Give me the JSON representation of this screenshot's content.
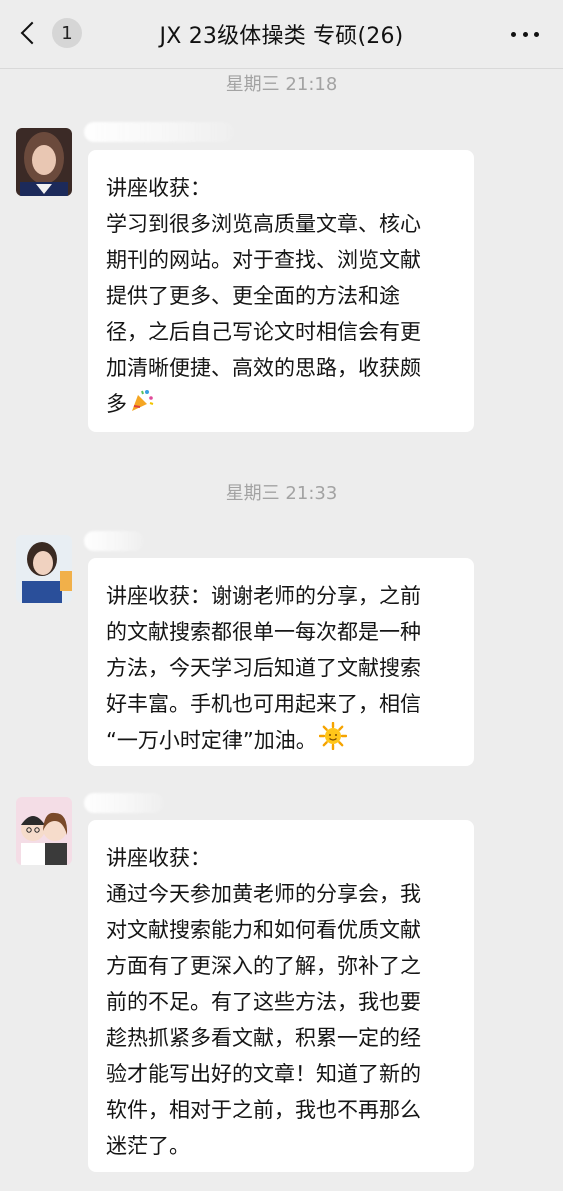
{
  "header": {
    "back_count": "1",
    "title": "JX 23级体操类 专硕(26)"
  },
  "messages": [
    {
      "time": "星期三 21:18",
      "lines": [
        "讲座收获：",
        "学习到很多浏览高质量文章、核心",
        "期刊的网站。对于查找、浏览文献",
        "提供了更多、更全面的方法和途",
        "径，之后自己写论文时相信会有更",
        "加清晰便捷、高效的思路，收获颇",
        "多"
      ],
      "emoji": "party-popper-icon"
    },
    {
      "time": "星期三 21:33",
      "lines": [
        "讲座收获：谢谢老师的分享，之前",
        "的文献搜索都很单一每次都是一种",
        "方法，今天学习后知道了文献搜索",
        "好丰富。手机也可用起来了，相信",
        "“一万小时定律”加油。"
      ],
      "emoji": "sun-icon"
    },
    {
      "lines": [
        "讲座收获：",
        "通过今天参加黄老师的分享会，我",
        "对文献搜索能力和如何看优质文献",
        "方面有了更深入的了解，弥补了之",
        "前的不足。有了这些方法，我也要",
        "趁热抓紧多看文献，积累一定的经",
        "验才能写出好的文章！知道了新的",
        "软件，相对于之前，我也不再那么",
        "迷茫了。"
      ]
    }
  ]
}
